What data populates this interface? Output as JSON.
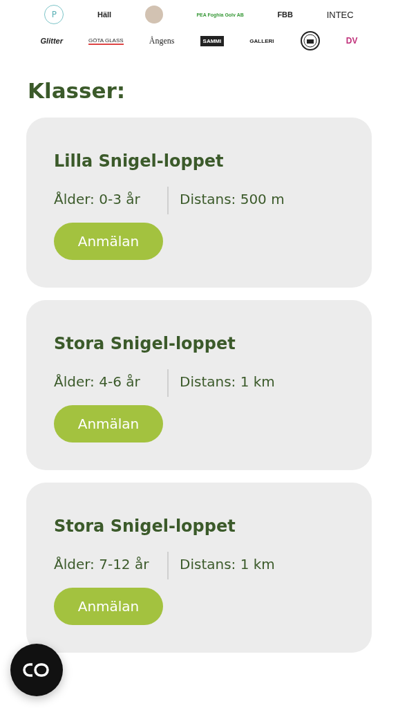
{
  "logo_rows": [
    [
      {
        "kind": "badge",
        "text": "P"
      },
      {
        "kind": "wordmark",
        "text": "Häll"
      },
      {
        "kind": "disc"
      },
      {
        "kind": "wordmark",
        "text": "PEA Foghia Golv AB"
      },
      {
        "kind": "wordmark",
        "text": "FBB"
      },
      {
        "kind": "wordmark",
        "text": "INTEC"
      }
    ],
    [
      {
        "kind": "wordmark",
        "text": "Glitter"
      },
      {
        "kind": "wordmark",
        "text": "GÖTA GLASS"
      },
      {
        "kind": "wordmark",
        "text": "Ångens"
      },
      {
        "kind": "plate",
        "text": "SAMMI"
      },
      {
        "kind": "wordmark",
        "text": "GALLERI"
      },
      {
        "kind": "seal"
      },
      {
        "kind": "wordmark",
        "text": "DV"
      }
    ]
  ],
  "heading": "Klasser:",
  "classes": [
    {
      "title": "Lilla Snigel-loppet",
      "age": "Ålder: 0-3 år",
      "distance": "Distans: 500 m",
      "button": "Anmälan"
    },
    {
      "title": "Stora Snigel-loppet",
      "age": "Ålder: 4-6 år",
      "distance": "Distans: 1 km",
      "button": "Anmälan"
    },
    {
      "title": "Stora Snigel-loppet",
      "age": "Ålder: 7-12 år",
      "distance": "Distans: 1 km",
      "button": "Anmälan"
    }
  ]
}
